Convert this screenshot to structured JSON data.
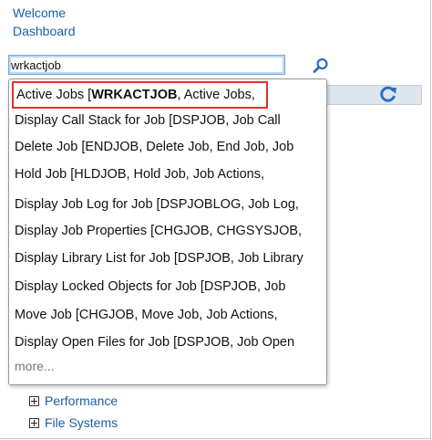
{
  "nav": {
    "welcome": "Welcome",
    "dashboard": "Dashboard"
  },
  "search": {
    "value": "wrkactjob",
    "icon": "search-icon"
  },
  "suggestions": {
    "first": {
      "prefix": "Active Jobs [",
      "highlight": "WRKACTJOB",
      "suffix": ", Active Jobs,"
    },
    "items": [
      "Display Call Stack for Job [DSPJOB, Job Call",
      "Delete Job [ENDJOB, Delete Job, End Job, Job",
      "Hold Job [HLDJOB, Hold Job, Job Actions,",
      "Display Job Log for Job [DSPJOBLOG, Job Log,",
      "Display Job Properties [CHGJOB, CHGSYSJOB,",
      "Display Library List for Job [DSPJOB, Job Library",
      "Display Locked Objects for Job [DSPJOB, Job",
      "Move Job [CHGJOB, Move Job, Job Actions,",
      "Display Open Files for Job [DSPJOB, Job Open"
    ],
    "more": "more..."
  },
  "tree": {
    "performance": "Performance",
    "file_systems": "File Systems"
  },
  "colors": {
    "link": "#1a5ea8",
    "highlight_border": "#e0302a",
    "input_focus": "#78a7d8"
  }
}
